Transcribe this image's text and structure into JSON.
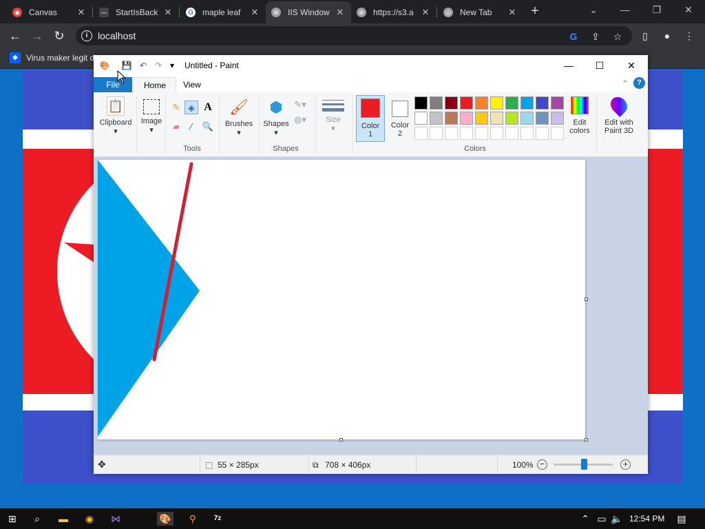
{
  "browser": {
    "tabs": [
      {
        "title": "Canvas",
        "favicon": "canvas-icon",
        "color": "#e0413c"
      },
      {
        "title": "StartIsBack",
        "favicon": "startisback-icon",
        "color": "#444444"
      },
      {
        "title": "maple leaf",
        "favicon": "google-icon",
        "color": "#ffffff"
      },
      {
        "title": "IIS Window",
        "favicon": "globe-icon",
        "color": "#9aa0a6"
      },
      {
        "title": "https://s3.a",
        "favicon": "globe-icon",
        "color": "#9aa0a6"
      },
      {
        "title": "New Tab",
        "favicon": "chrome-icon",
        "color": "#9aa0a6"
      }
    ],
    "active_tab_index": 3,
    "close_glyph": "✕",
    "new_tab_glyph": "+",
    "url": "localhost",
    "bookmark": "Virus maker legit d"
  },
  "paint": {
    "title": "Untitled - Paint",
    "tabs": {
      "file": "File",
      "home": "Home",
      "view": "View"
    },
    "groups": {
      "clipboard": "Clipboard",
      "image": "Image",
      "tools": "Tools",
      "brushes": "Brushes",
      "shapes": "Shapes",
      "shapes_group": "Shapes",
      "size": "Size",
      "color1": "Color",
      "color1_num": "1",
      "color2": "Color",
      "color2_num": "2",
      "colors": "Colors",
      "edit_colors_1": "Edit",
      "edit_colors_2": "colors",
      "paint3d_1": "Edit with",
      "paint3d_2": "Paint 3D"
    },
    "color1_value": "#ed1c24",
    "color2_value": "#ffffff",
    "palette_row1": [
      "#000000",
      "#7f7f7f",
      "#880015",
      "#ed1c24",
      "#ff7f27",
      "#fff200",
      "#22b14c",
      "#00a2e8",
      "#3f48cc",
      "#a349a4"
    ],
    "palette_row2": [
      "#ffffff",
      "#c3c3c3",
      "#b97a57",
      "#ffaec9",
      "#ffc90e",
      "#efe4b0",
      "#b5e61d",
      "#99d9ea",
      "#7092be",
      "#c8bfe7"
    ],
    "status": {
      "cursor": "55 × 285px",
      "canvas_size": "708 × 406px",
      "zoom": "100%"
    }
  },
  "taskbar": {
    "time": "12:54 PM"
  }
}
